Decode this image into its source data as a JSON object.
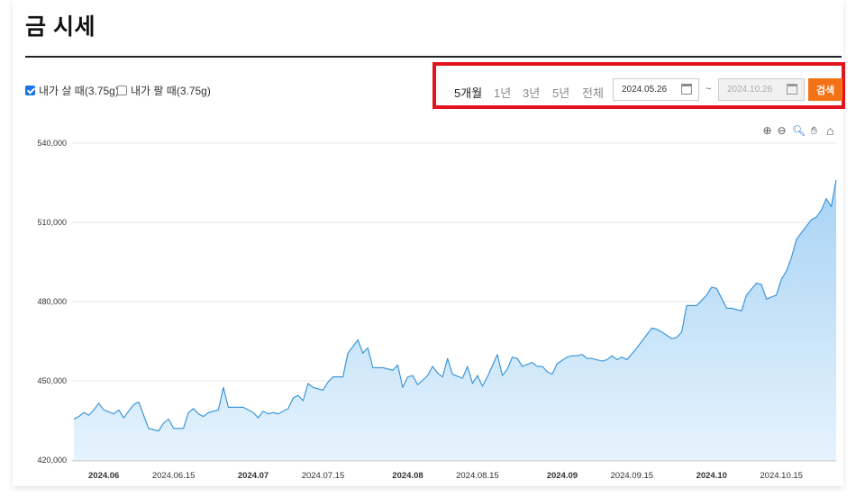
{
  "page": {
    "title": "금 시세"
  },
  "options": {
    "buy": {
      "label": "내가 살 때(3.75g)",
      "checked": true
    },
    "sell": {
      "label": "내가 팔 때(3.75g)",
      "checked": false
    }
  },
  "periods": [
    "5개월",
    "1년",
    "3년",
    "5년",
    "전체"
  ],
  "active_period": "5개월",
  "date_from": "2024.05.26",
  "date_sep": "~",
  "date_to": "2024.10.26",
  "search_label": "검색",
  "toolbar": [
    "zoom-in-icon",
    "zoom-out-icon",
    "magnifier-icon",
    "pan-hand-icon",
    "home-icon"
  ],
  "colors": {
    "accent": "#f47216",
    "highlight": "#e1141e",
    "line": "#2f8fd8",
    "fill_top": "#a7d3f5",
    "fill_bottom": "#e6f3fd"
  },
  "chart_data": {
    "type": "area",
    "title": "",
    "xlabel": "",
    "ylabel": "",
    "ylim": [
      420000,
      540000
    ],
    "xlim": [
      "2024-05-26",
      "2024-10-26"
    ],
    "yticks": [
      420000,
      450000,
      480000,
      510000,
      540000
    ],
    "ytick_labels": [
      "420,000",
      "450,000",
      "480,000",
      "510,000",
      "540,000"
    ],
    "xticks": [
      {
        "date": "2024-06-01",
        "label": "2024.06",
        "bold": true
      },
      {
        "date": "2024-06-15",
        "label": "2024.06.15",
        "bold": false
      },
      {
        "date": "2024-07-01",
        "label": "2024.07",
        "bold": true
      },
      {
        "date": "2024-07-15",
        "label": "2024.07.15",
        "bold": false
      },
      {
        "date": "2024-08-01",
        "label": "2024.08",
        "bold": true
      },
      {
        "date": "2024-08-15",
        "label": "2024.08.15",
        "bold": false
      },
      {
        "date": "2024-09-01",
        "label": "2024.09",
        "bold": true
      },
      {
        "date": "2024-09-15",
        "label": "2024.09.15",
        "bold": false
      },
      {
        "date": "2024-10-01",
        "label": "2024.10",
        "bold": true
      },
      {
        "date": "2024-10-15",
        "label": "2024.10.15",
        "bold": false
      }
    ],
    "grid": true,
    "series": [
      {
        "x": [
          "2024-05-26",
          "2024-05-27",
          "2024-05-28",
          "2024-05-29",
          "2024-05-30",
          "2024-05-31",
          "2024-06-01",
          "2024-06-03",
          "2024-06-04",
          "2024-06-05",
          "2024-06-06",
          "2024-06-07",
          "2024-06-08",
          "2024-06-10",
          "2024-06-11",
          "2024-06-12",
          "2024-06-13",
          "2024-06-14",
          "2024-06-15",
          "2024-06-17",
          "2024-06-18",
          "2024-06-19",
          "2024-06-20",
          "2024-06-21",
          "2024-06-22",
          "2024-06-24",
          "2024-06-25",
          "2024-06-26",
          "2024-06-27",
          "2024-06-28",
          "2024-06-29",
          "2024-07-01",
          "2024-07-02",
          "2024-07-03",
          "2024-07-04",
          "2024-07-05",
          "2024-07-06",
          "2024-07-08",
          "2024-07-09",
          "2024-07-10",
          "2024-07-11",
          "2024-07-12",
          "2024-07-13",
          "2024-07-15",
          "2024-07-16",
          "2024-07-17",
          "2024-07-18",
          "2024-07-19",
          "2024-07-20",
          "2024-07-22",
          "2024-07-23",
          "2024-07-24",
          "2024-07-25",
          "2024-07-26",
          "2024-07-27",
          "2024-07-29",
          "2024-07-30",
          "2024-07-31",
          "2024-08-01",
          "2024-08-02",
          "2024-08-03",
          "2024-08-05",
          "2024-08-06",
          "2024-08-07",
          "2024-08-08",
          "2024-08-09",
          "2024-08-10",
          "2024-08-12",
          "2024-08-13",
          "2024-08-14",
          "2024-08-15",
          "2024-08-16",
          "2024-08-17",
          "2024-08-19",
          "2024-08-20",
          "2024-08-21",
          "2024-08-22",
          "2024-08-23",
          "2024-08-24",
          "2024-08-26",
          "2024-08-27",
          "2024-08-28",
          "2024-08-29",
          "2024-08-30",
          "2024-08-31",
          "2024-09-02",
          "2024-09-03",
          "2024-09-04",
          "2024-09-05",
          "2024-09-06",
          "2024-09-07",
          "2024-09-09",
          "2024-09-10",
          "2024-09-11",
          "2024-09-12",
          "2024-09-13",
          "2024-09-14",
          "2024-09-16",
          "2024-09-19",
          "2024-09-20",
          "2024-09-21",
          "2024-09-23",
          "2024-09-24",
          "2024-09-25",
          "2024-09-26",
          "2024-09-27",
          "2024-09-28",
          "2024-09-30",
          "2024-10-01",
          "2024-10-02",
          "2024-10-04",
          "2024-10-05",
          "2024-10-07",
          "2024-10-08",
          "2024-10-10",
          "2024-10-11",
          "2024-10-12",
          "2024-10-14",
          "2024-10-15",
          "2024-10-16",
          "2024-10-17",
          "2024-10-18",
          "2024-10-19",
          "2024-10-21",
          "2024-10-22",
          "2024-10-23",
          "2024-10-24",
          "2024-10-25",
          "2024-10-26"
        ],
        "y": [
          435500,
          436500,
          438000,
          437000,
          439000,
          441500,
          439000,
          437500,
          439000,
          436000,
          438500,
          441000,
          442000,
          432000,
          431500,
          431000,
          434000,
          435500,
          432000,
          432000,
          438000,
          439500,
          437500,
          436500,
          438000,
          439000,
          447500,
          440000,
          440000,
          440000,
          440000,
          438000,
          436000,
          438500,
          437500,
          438000,
          437500,
          439500,
          443500,
          444500,
          442500,
          449000,
          447500,
          446500,
          449500,
          451500,
          451500,
          451500,
          460500,
          465500,
          460500,
          462500,
          455000,
          455000,
          455000,
          454000,
          456000,
          447500,
          451500,
          452000,
          448500,
          452000,
          455500,
          453000,
          451500,
          458500,
          452500,
          451000,
          455500,
          449000,
          452000,
          448000,
          451500,
          460000,
          452000,
          454500,
          459000,
          458500,
          455500,
          457000,
          455500,
          455500,
          453500,
          452500,
          456500,
          459000,
          459500,
          459500,
          460000,
          458500,
          458500,
          457500,
          458000,
          459500,
          458000,
          459000,
          458000,
          462500,
          470000,
          469500,
          468500,
          466000,
          466500,
          468500,
          478500,
          478500,
          478500,
          482500,
          485500,
          485000,
          477500,
          477500,
          476500,
          482500,
          487000,
          486500,
          481000,
          482500,
          488500,
          491500,
          496500,
          503500,
          506000,
          511000,
          512000,
          514500,
          519000,
          516000,
          526000
        ]
      }
    ]
  }
}
